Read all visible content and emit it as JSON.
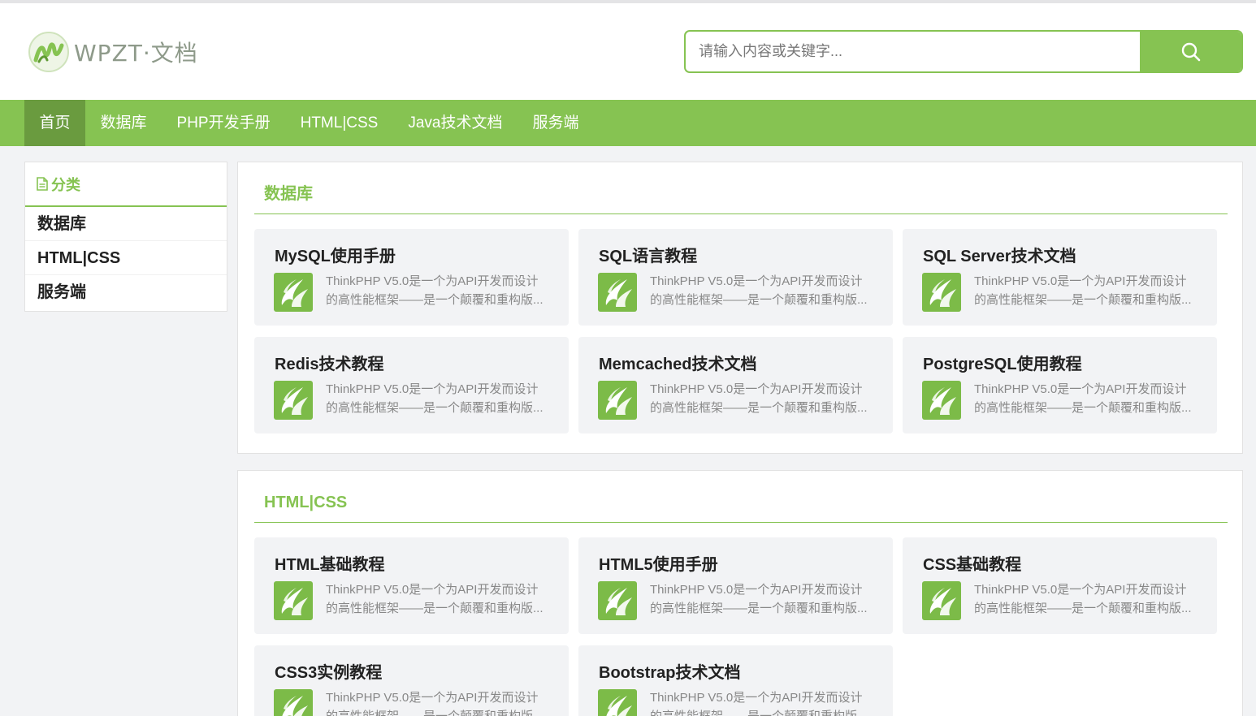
{
  "header": {
    "logo_text": "WPZT·文档",
    "search_placeholder": "请输入内容或关键字..."
  },
  "nav": {
    "items": [
      {
        "label": "首页",
        "active": true
      },
      {
        "label": "数据库",
        "active": false
      },
      {
        "label": "PHP开发手册",
        "active": false
      },
      {
        "label": "HTML|CSS",
        "active": false
      },
      {
        "label": "Java技术文档",
        "active": false
      },
      {
        "label": "服务端",
        "active": false
      }
    ]
  },
  "sidebar": {
    "title": "分类",
    "items": [
      {
        "label": "数据库"
      },
      {
        "label": "HTML|CSS"
      },
      {
        "label": "服务端"
      }
    ]
  },
  "sections": [
    {
      "title": "数据库",
      "cards": [
        {
          "title": "MySQL使用手册",
          "desc_line1": "ThinkPHP V5.0是一个为API开发而设计",
          "desc_line2": "的高性能框架——是一个颠覆和重构版..."
        },
        {
          "title": "SQL语言教程",
          "desc_line1": "ThinkPHP V5.0是一个为API开发而设计",
          "desc_line2": "的高性能框架——是一个颠覆和重构版..."
        },
        {
          "title": "SQL Server技术文档",
          "desc_line1": "ThinkPHP V5.0是一个为API开发而设计",
          "desc_line2": "的高性能框架——是一个颠覆和重构版..."
        },
        {
          "title": "Redis技术教程",
          "desc_line1": "ThinkPHP V5.0是一个为API开发而设计",
          "desc_line2": "的高性能框架——是一个颠覆和重构版..."
        },
        {
          "title": "Memcached技术文档",
          "desc_line1": "ThinkPHP V5.0是一个为API开发而设计",
          "desc_line2": "的高性能框架——是一个颠覆和重构版..."
        },
        {
          "title": "PostgreSQL使用教程",
          "desc_line1": "ThinkPHP V5.0是一个为API开发而设计",
          "desc_line2": "的高性能框架——是一个颠覆和重构版..."
        }
      ]
    },
    {
      "title": "HTML|CSS",
      "cards": [
        {
          "title": "HTML基础教程",
          "desc_line1": "ThinkPHP V5.0是一个为API开发而设计",
          "desc_line2": "的高性能框架——是一个颠覆和重构版..."
        },
        {
          "title": "HTML5使用手册",
          "desc_line1": "ThinkPHP V5.0是一个为API开发而设计",
          "desc_line2": "的高性能框架——是一个颠覆和重构版..."
        },
        {
          "title": "CSS基础教程",
          "desc_line1": "ThinkPHP V5.0是一个为API开发而设计",
          "desc_line2": "的高性能框架——是一个颠覆和重构版..."
        },
        {
          "title": "CSS3实例教程",
          "desc_line1": "ThinkPHP V5.0是一个为API开发而设计",
          "desc_line2": "的高性能框架——是一个颠覆和重构版..."
        },
        {
          "title": "Bootstrap技术文档",
          "desc_line1": "ThinkPHP V5.0是一个为API开发而设计",
          "desc_line2": "的高性能框架——是一个颠覆和重构版..."
        }
      ]
    }
  ],
  "colors": {
    "accent": "#86c352",
    "accent_dark": "#6a9b3f",
    "background": "#f2f3f5"
  },
  "icons": {
    "search": "search-icon",
    "category": "document-icon",
    "card": "thinkphp-logo-icon"
  }
}
